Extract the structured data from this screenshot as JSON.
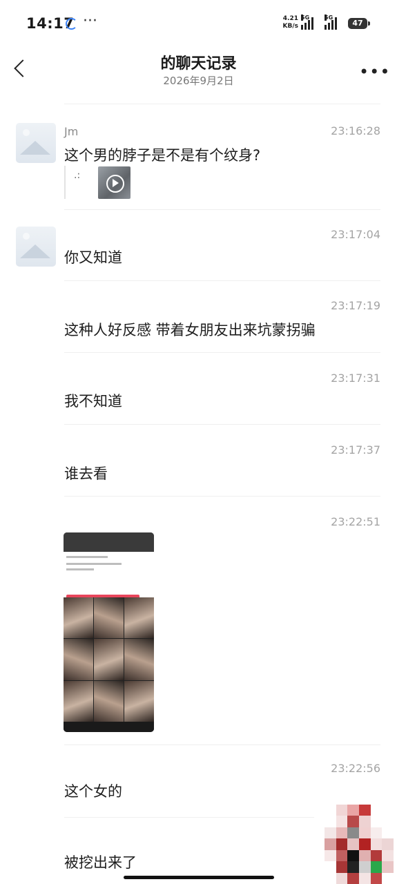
{
  "status_bar": {
    "time": "14:17",
    "dots": "···",
    "speed_value": "4.21",
    "speed_unit": "KB/s",
    "sim1": "5G",
    "sim2": "5G",
    "battery": "47"
  },
  "header": {
    "title": "的聊天记录",
    "date": "2026年9月2日",
    "more": "•••"
  },
  "messages": [
    {
      "sender": "Jm",
      "time": "23:16:28",
      "text": "这个男的脖子是不是有个纹身?",
      "quote_text": ".:"
    },
    {
      "time": "23:17:04",
      "text": "你又知道"
    },
    {
      "time": "23:17:19",
      "text": "这种人好反感 带着女朋友出来坑蒙拐骗"
    },
    {
      "time": "23:17:31",
      "text": "我不知道"
    },
    {
      "time": "23:17:37",
      "text": "谁去看"
    },
    {
      "time": "23:22:51"
    },
    {
      "time": "23:22:56",
      "text": "这个女的"
    },
    {
      "text": "被挖出来了"
    }
  ],
  "colors": {
    "accent_red": "#e8455b",
    "timestamp": "#a4a4a4"
  }
}
